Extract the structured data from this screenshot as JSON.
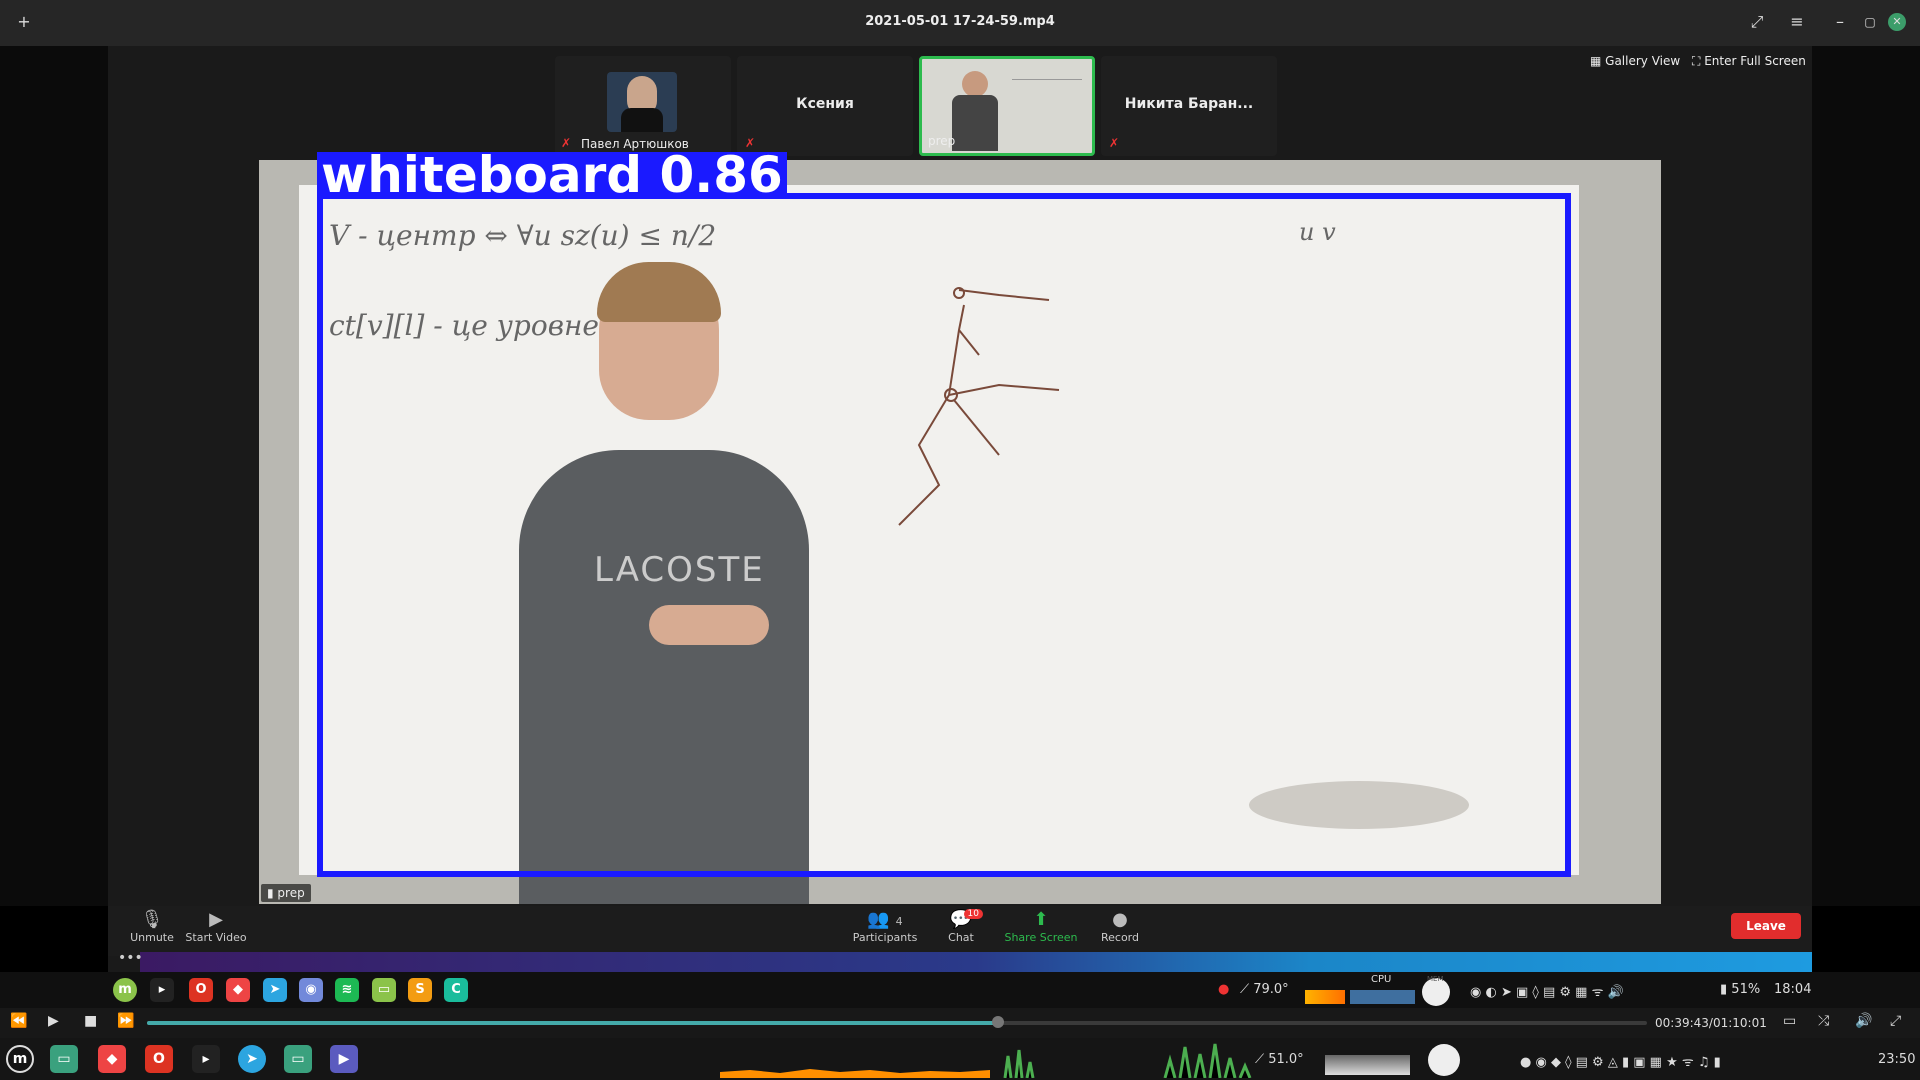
{
  "window": {
    "title": "2021-05-01 17-24-59.mp4",
    "new_tab": "+",
    "menu": "≡",
    "minimize": "–",
    "maximize": "▢",
    "close": "✕"
  },
  "zoom": {
    "gallery_view": "Gallery View",
    "full_screen": "Enter Full Screen",
    "participants_strip": [
      {
        "name": "Павел Артюшков",
        "muted": true
      },
      {
        "name": "Ксения",
        "muted": true
      },
      {
        "name": "prep",
        "muted": false
      },
      {
        "name": "Никита Баран...",
        "muted": true
      }
    ],
    "active_speaker_tag": "prep",
    "detection": {
      "label": "whiteboard 0.86",
      "color": "#1a1aff"
    },
    "board_text": {
      "line1": "V - центр  ⇔  ∀u     sz(u) ≤ n/2",
      "line2": "ct[v][l] - це          уровне l",
      "corner": "u     v"
    },
    "toolbar": {
      "unmute": "Unmute",
      "start_video": "Start Video",
      "participants": "Participants",
      "participants_count": "4",
      "chat": "Chat",
      "chat_badge": "10",
      "share_screen": "Share Screen",
      "record": "Record",
      "leave": "Leave"
    }
  },
  "tray": {
    "temp": "79.0°",
    "cpu_label": "CPU",
    "mem_label": "MEM",
    "battery": "51%",
    "time": "18:04"
  },
  "player": {
    "time": "00:39:43/01:10:01",
    "progress": 0.567
  },
  "system_bar": {
    "temp": "51.0°",
    "time": "23:50"
  },
  "colors": {
    "accent_green": "#2dbb4e",
    "leave_red": "#e12d2d"
  }
}
